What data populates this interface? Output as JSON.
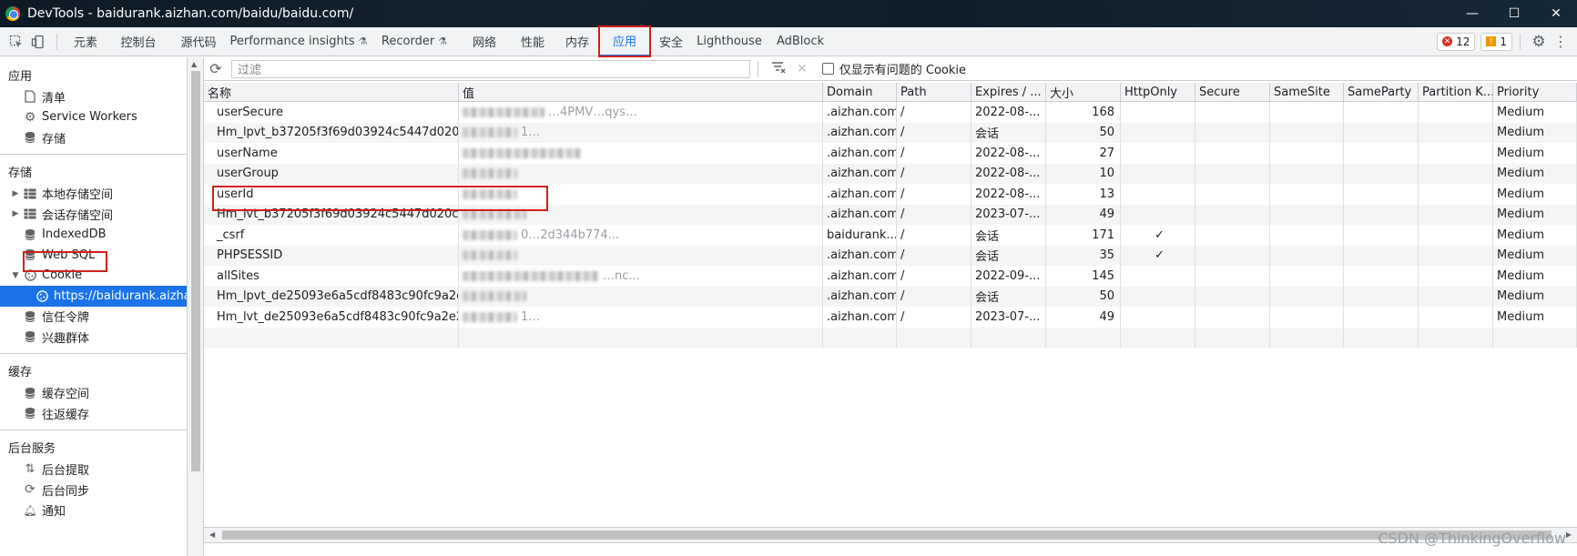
{
  "window": {
    "title": "DevTools - baidurank.aizhan.com/baidu/baidu.com/",
    "controls": [
      "—",
      "☐",
      "✕"
    ]
  },
  "tabs": [
    {
      "label": "元素",
      "flask": false,
      "active": false
    },
    {
      "label": "控制台",
      "flask": false,
      "active": false
    },
    {
      "label": "源代码",
      "flask": false,
      "active": false
    },
    {
      "label": "Performance insights",
      "flask": true,
      "active": false
    },
    {
      "label": "Recorder",
      "flask": true,
      "active": false
    },
    {
      "label": "网络",
      "flask": false,
      "active": false
    },
    {
      "label": "性能",
      "flask": false,
      "active": false
    },
    {
      "label": "内存",
      "flask": false,
      "active": false
    },
    {
      "label": "应用",
      "flask": false,
      "active": true
    },
    {
      "label": "安全",
      "flask": false,
      "active": false
    },
    {
      "label": "Lighthouse",
      "flask": false,
      "active": false
    },
    {
      "label": "AdBlock",
      "flask": false,
      "active": false
    }
  ],
  "badges": {
    "errors": "12",
    "warnings": "1"
  },
  "sidebar": {
    "app_header": "应用",
    "app_items": [
      {
        "label": "清单",
        "icon": "file-icon"
      },
      {
        "label": "Service Workers",
        "icon": "gear-icon"
      },
      {
        "label": "存储",
        "icon": "database-icon"
      }
    ],
    "storage_header": "存储",
    "storage_items": [
      {
        "label": "本地存储空间",
        "icon": "table-icon",
        "expand": "collapsed"
      },
      {
        "label": "会话存储空间",
        "icon": "table-icon",
        "expand": "collapsed"
      },
      {
        "label": "IndexedDB",
        "icon": "database-icon",
        "expand": "none"
      },
      {
        "label": "Web SQL",
        "icon": "database-icon",
        "expand": "none"
      },
      {
        "label": "Cookie",
        "icon": "cookie-icon",
        "expand": "expanded"
      }
    ],
    "cookie_child": "https://baidurank.aizhan.com",
    "storage_items_after": [
      {
        "label": "信任令牌",
        "icon": "database-icon"
      },
      {
        "label": "兴趣群体",
        "icon": "database-icon"
      }
    ],
    "cache_header": "缓存",
    "cache_items": [
      {
        "label": "缓存空间",
        "icon": "database-icon"
      },
      {
        "label": "往返缓存",
        "icon": "database-icon"
      }
    ],
    "bg_header": "后台服务",
    "bg_items": [
      {
        "label": "后台提取",
        "icon": "updown-icon"
      },
      {
        "label": "后台同步",
        "icon": "sync-icon"
      },
      {
        "label": "通知",
        "icon": "bell-icon"
      }
    ]
  },
  "toolbar": {
    "filter_placeholder": "过滤",
    "only_issues_label": "仅显示有问题的 Cookie"
  },
  "columns": [
    "名称",
    "值",
    "Domain",
    "Path",
    "Expires / ...",
    "大小",
    "HttpOnly",
    "Secure",
    "SameSite",
    "SameParty",
    "Partition K...",
    "Priority"
  ],
  "rows": [
    {
      "name": "userSecure",
      "value": "…4PMV…qys…",
      "domain": ".aizhan.com",
      "path": "/",
      "expires": "2022-08-...",
      "size": "168",
      "httponly": "",
      "secure": "",
      "samesite": "",
      "sameparty": "",
      "partition": "",
      "priority": "Medium"
    },
    {
      "name": "Hm_lpvt_b37205f3f69d03924c5447d020c...",
      "value": "1…",
      "domain": ".aizhan.com",
      "path": "/",
      "expires": "会话",
      "size": "50",
      "httponly": "",
      "secure": "",
      "samesite": "",
      "sameparty": "",
      "partition": "",
      "priority": "Medium"
    },
    {
      "name": "userName",
      "value": "",
      "domain": ".aizhan.com",
      "path": "/",
      "expires": "2022-08-...",
      "size": "27",
      "httponly": "",
      "secure": "",
      "samesite": "",
      "sameparty": "",
      "partition": "",
      "priority": "Medium"
    },
    {
      "name": "userGroup",
      "value": "",
      "domain": ".aizhan.com",
      "path": "/",
      "expires": "2022-08-...",
      "size": "10",
      "httponly": "",
      "secure": "",
      "samesite": "",
      "sameparty": "",
      "partition": "",
      "priority": "Medium"
    },
    {
      "name": "userId",
      "value": "",
      "domain": ".aizhan.com",
      "path": "/",
      "expires": "2022-08-...",
      "size": "13",
      "httponly": "",
      "secure": "",
      "samesite": "",
      "sameparty": "",
      "partition": "",
      "priority": "Medium"
    },
    {
      "name": "Hm_lvt_b37205f3f69d03924c5447d020c0...",
      "value": "",
      "domain": ".aizhan.com",
      "path": "/",
      "expires": "2023-07-...",
      "size": "49",
      "httponly": "",
      "secure": "",
      "samesite": "",
      "sameparty": "",
      "partition": "",
      "priority": "Medium"
    },
    {
      "name": "_csrf",
      "value": "0…2d344b774...",
      "domain": "baidurank...",
      "path": "/",
      "expires": "会话",
      "size": "171",
      "httponly": "✓",
      "secure": "",
      "samesite": "",
      "sameparty": "",
      "partition": "",
      "priority": "Medium"
    },
    {
      "name": "PHPSESSID",
      "value": "",
      "domain": ".aizhan.com",
      "path": "/",
      "expires": "会话",
      "size": "35",
      "httponly": "✓",
      "secure": "",
      "samesite": "",
      "sameparty": "",
      "partition": "",
      "priority": "Medium"
    },
    {
      "name": "allSites",
      "value": "…nc...",
      "domain": ".aizhan.com",
      "path": "/",
      "expires": "2022-09-...",
      "size": "145",
      "httponly": "",
      "secure": "",
      "samesite": "",
      "sameparty": "",
      "partition": "",
      "priority": "Medium"
    },
    {
      "name": "Hm_lpvt_de25093e6a5cdf8483c90fc9a2e2...",
      "value": "",
      "domain": ".aizhan.com",
      "path": "/",
      "expires": "会话",
      "size": "50",
      "httponly": "",
      "secure": "",
      "samesite": "",
      "sameparty": "",
      "partition": "",
      "priority": "Medium"
    },
    {
      "name": "Hm_lvt_de25093e6a5cdf8483c90fc9a2e2c...",
      "value": "1…",
      "domain": ".aizhan.com",
      "path": "/",
      "expires": "2023-07-...",
      "size": "49",
      "httponly": "",
      "secure": "",
      "samesite": "",
      "sameparty": "",
      "partition": "",
      "priority": "Medium"
    }
  ],
  "watermark": "CSDN @ThinkingOverflow"
}
